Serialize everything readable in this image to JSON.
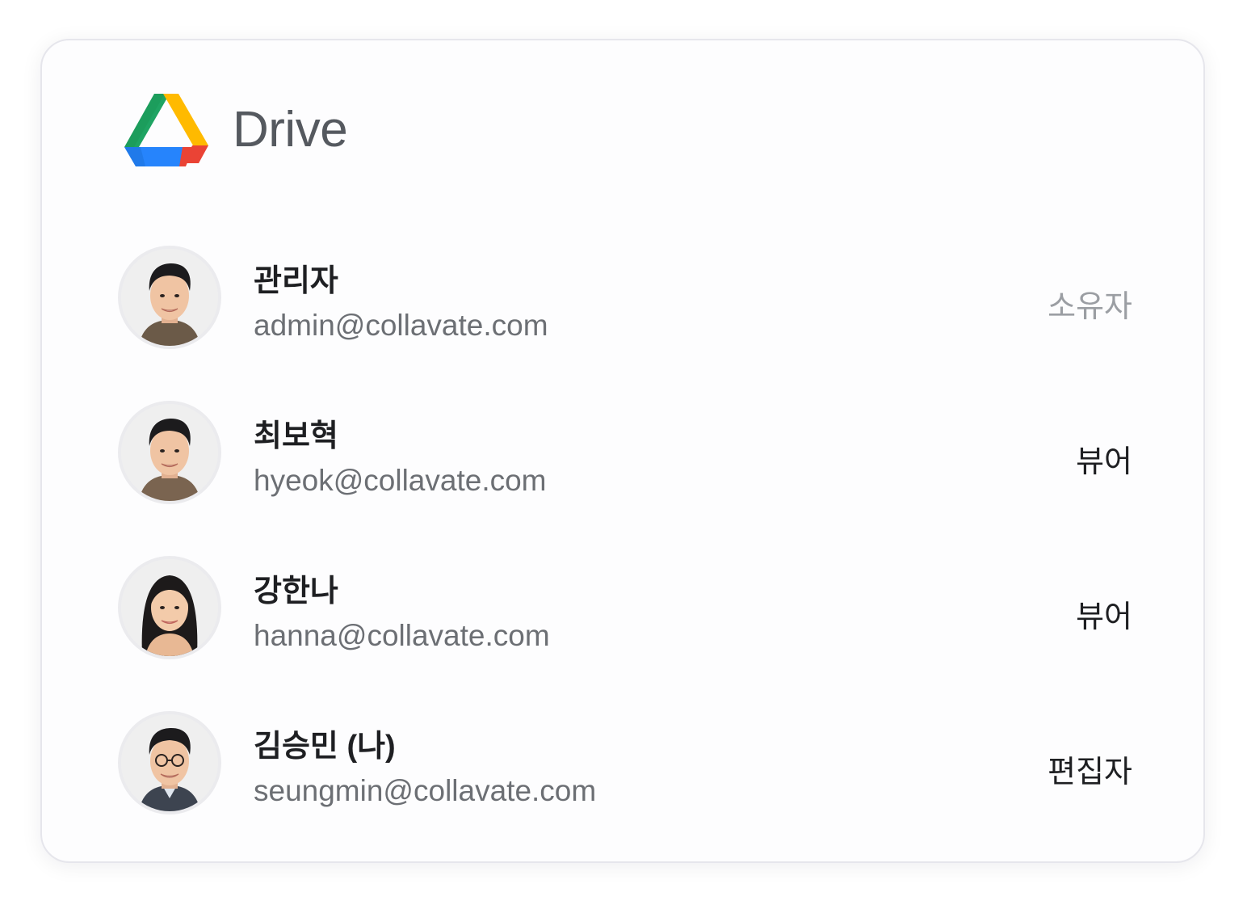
{
  "app": {
    "title": "Drive",
    "logo_icon": "google-drive-logo"
  },
  "colors": {
    "logo_green": "#1FA463",
    "logo_yellow": "#FFC107",
    "logo_blue": "#2684FC",
    "logo_red": "#EA4335",
    "title_gray": "#55595F",
    "email_gray": "#6C6F74",
    "owner_gray": "#9B9EA3"
  },
  "members": [
    {
      "name": "관리자",
      "email": "admin@collavate.com",
      "role": "소유자",
      "role_muted": true,
      "avatar": "man-photo-avatar"
    },
    {
      "name": "최보혁",
      "email": "hyeok@collavate.com",
      "role": "뷰어",
      "role_muted": false,
      "avatar": "man-photo-avatar"
    },
    {
      "name": "강한나",
      "email": "hanna@collavate.com",
      "role": "뷰어",
      "role_muted": false,
      "avatar": "woman-photo-avatar"
    },
    {
      "name": "김승민 (나)",
      "email": "seungmin@collavate.com",
      "role": "편집자",
      "role_muted": false,
      "avatar": "man-with-glasses-photo-avatar"
    }
  ]
}
